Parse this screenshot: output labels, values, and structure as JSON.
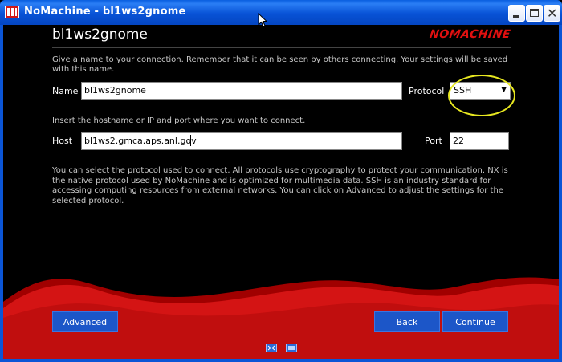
{
  "window": {
    "title": "NoMachine - bl1ws2gnome",
    "app_icon": "nomachine-app-icon",
    "controls": [
      "minimize-icon",
      "maximize-icon",
      "close-icon"
    ]
  },
  "header": {
    "connection_title": "bl1ws2gnome",
    "logo_text": "NOMACHINE"
  },
  "texts": {
    "name_description": "Give a name to your connection. Remember that it can be seen by others connecting. Your settings will be saved with this name.",
    "host_description": "Insert the hostname or IP and port where you want to connect.",
    "protocol_description": "You can select the protocol used to connect. All protocols use cryptography to protect your communication. NX is the native protocol used by NoMachine and is optimized for multimedia data. SSH is an industry standard for accessing computing resources from external networks. You can click on Advanced to adjust the settings for the selected protocol."
  },
  "form": {
    "name_label": "Name",
    "name_value": "bl1ws2gnome",
    "protocol_label": "Protocol",
    "protocol_value": "SSH",
    "host_label": "Host",
    "host_value": "bl1ws2.gmca.aps.anl.gov",
    "port_label": "Port",
    "port_value": "22"
  },
  "buttons": {
    "advanced": "Advanced",
    "back": "Back",
    "continue": "Continue"
  },
  "colors": {
    "titlebar": "#0852d6",
    "background": "#000000",
    "accent_red": "#d41414",
    "button_blue": "#1c56c8",
    "annotation": "#e8e820"
  },
  "tray_icons": [
    "fullscreen-icon",
    "display-icon"
  ]
}
